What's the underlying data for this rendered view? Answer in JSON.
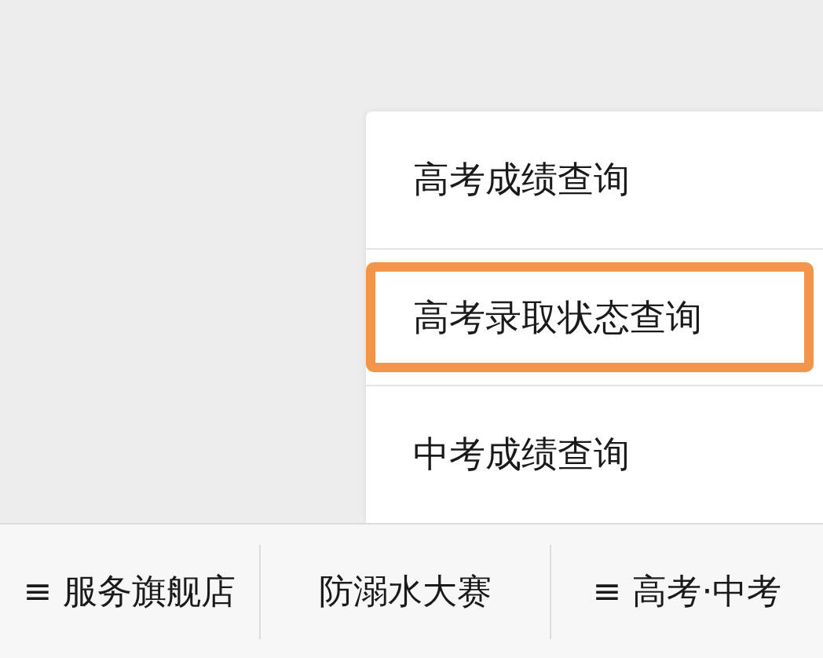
{
  "popup_menu": {
    "items": [
      {
        "label": "高考成绩查询",
        "highlighted": false
      },
      {
        "label": "高考录取状态查询",
        "highlighted": true
      },
      {
        "label": "中考成绩查询",
        "highlighted": false
      }
    ]
  },
  "bottom_menu": {
    "items": [
      {
        "label": "≡ 服务旗舰店"
      },
      {
        "label": "防溺水大赛"
      },
      {
        "label": "≡ 高考·中考"
      }
    ]
  }
}
